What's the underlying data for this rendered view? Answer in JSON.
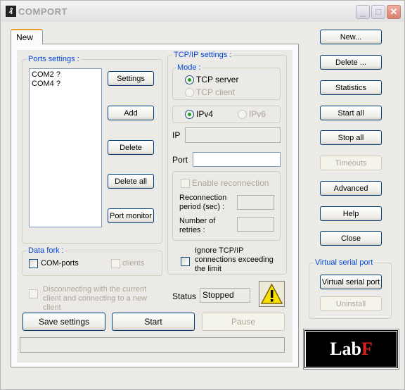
{
  "window": {
    "title": "COMPORT",
    "icon": "comport-app-icon",
    "controls": [
      "minimize",
      "maximize",
      "close"
    ]
  },
  "tabs": [
    {
      "label": "New",
      "active": true
    }
  ],
  "ports": {
    "group_label": "Ports settings :",
    "items": [
      "COM2 ?",
      "COM4 ?"
    ],
    "buttons": {
      "settings": "Settings",
      "add": "Add",
      "delete": "Delete",
      "delete_all": "Delete all",
      "port_monitor": "Port monitor"
    }
  },
  "tcpip": {
    "group_label": "TCP/IP settings :",
    "mode_label": "Mode :",
    "tcp_server": "TCP server",
    "tcp_client": "TCP client",
    "mode_selected": "TCP server",
    "ipv4": "IPv4",
    "ipv6": "IPv6",
    "ip_version_selected": "IPv4",
    "ip_label": "IP",
    "ip_value": "",
    "port_label": "Port",
    "port_value": "",
    "enable_reconnection": "Enable reconnection",
    "reconnection_period": "Reconnection period (sec) :",
    "number_of_retries": "Number of retries :",
    "ignore_connections": "Ignore TCP/IP connections exceeding the limit"
  },
  "data_fork": {
    "group_label": "Data fork :",
    "com_ports": "COM-ports",
    "clients": "clients"
  },
  "disconnecting": "Disconnecting with the current client and connecting to a new client",
  "status": {
    "label": "Status",
    "value": "Stopped"
  },
  "bottom_buttons": {
    "save": "Save settings",
    "start": "Start",
    "pause": "Pause"
  },
  "side_buttons": {
    "new": "New...",
    "delete": "Delete ...",
    "statistics": "Statistics",
    "start_all": "Start all",
    "stop_all": "Stop all",
    "timeouts": "Timeouts",
    "advanced": "Advanced",
    "help": "Help",
    "close": "Close"
  },
  "virtual_serial": {
    "group_label": "Virtual serial port",
    "install": "Virtual serial port",
    "uninstall": "Uninstall"
  },
  "logo": {
    "text_white": "Lab",
    "text_red": "F"
  }
}
